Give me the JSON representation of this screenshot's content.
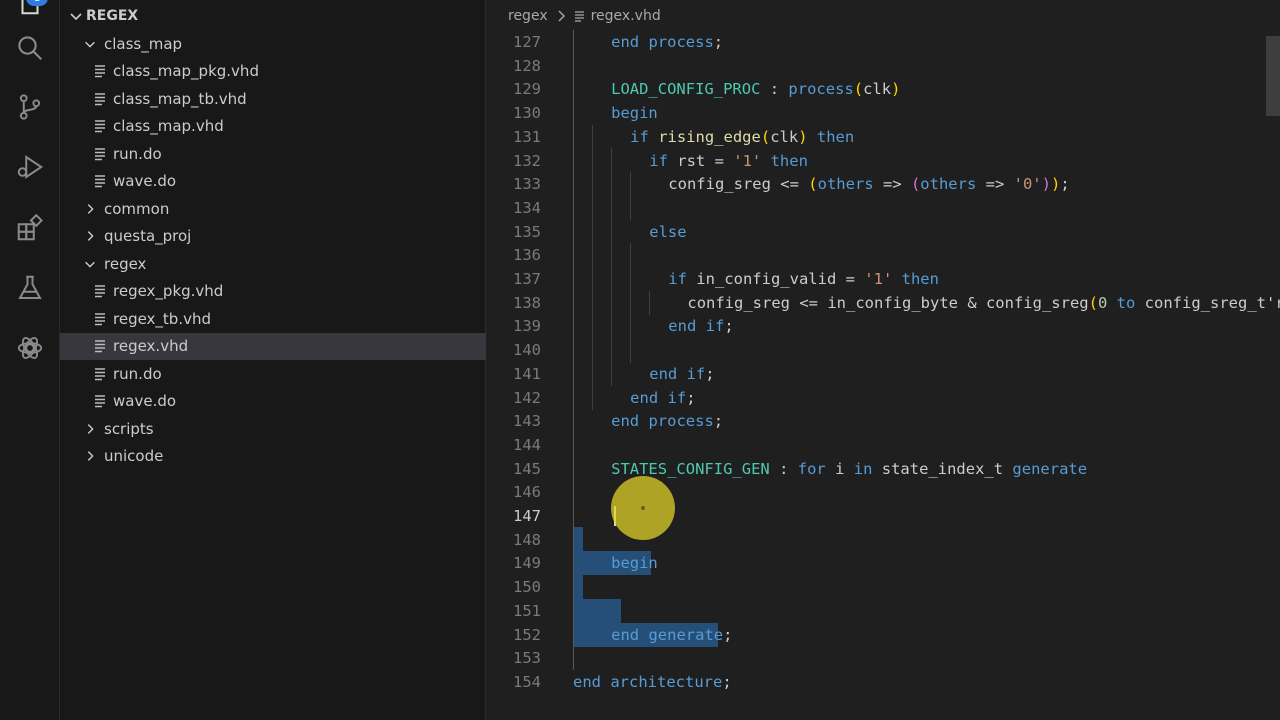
{
  "activity_bar": {
    "badge": "1",
    "icons": [
      "explorer-icon",
      "search-icon",
      "source-control-icon",
      "run-debug-icon",
      "extensions-icon",
      "testing-icon",
      "chatgpt-icon"
    ]
  },
  "explorer": {
    "root_label": "REGEX",
    "tree": [
      {
        "label": "class_map",
        "type": "folder",
        "expanded": true,
        "depth": 1
      },
      {
        "label": "class_map_pkg.vhd",
        "type": "file",
        "depth": 2
      },
      {
        "label": "class_map_tb.vhd",
        "type": "file",
        "depth": 2
      },
      {
        "label": "class_map.vhd",
        "type": "file",
        "depth": 2
      },
      {
        "label": "run.do",
        "type": "file",
        "depth": 2
      },
      {
        "label": "wave.do",
        "type": "file",
        "depth": 2
      },
      {
        "label": "common",
        "type": "folder",
        "expanded": false,
        "depth": 1
      },
      {
        "label": "questa_proj",
        "type": "folder",
        "expanded": false,
        "depth": 1
      },
      {
        "label": "regex",
        "type": "folder",
        "expanded": true,
        "depth": 1
      },
      {
        "label": "regex_pkg.vhd",
        "type": "file",
        "depth": 2
      },
      {
        "label": "regex_tb.vhd",
        "type": "file",
        "depth": 2
      },
      {
        "label": "regex.vhd",
        "type": "file",
        "depth": 2,
        "selected": true
      },
      {
        "label": "run.do",
        "type": "file",
        "depth": 2
      },
      {
        "label": "wave.do",
        "type": "file",
        "depth": 2
      },
      {
        "label": "scripts",
        "type": "folder",
        "expanded": false,
        "depth": 1
      },
      {
        "label": "unicode",
        "type": "folder",
        "expanded": false,
        "depth": 1
      }
    ]
  },
  "breadcrumb": {
    "folder": "regex",
    "file": "regex.vhd"
  },
  "editor": {
    "current_line": 147,
    "lines": [
      {
        "n": "127",
        "indent": 4,
        "tokens": [
          [
            "kw",
            "end"
          ],
          [
            "t",
            " "
          ],
          [
            "kw",
            "process"
          ],
          [
            "t",
            ";"
          ]
        ]
      },
      {
        "n": "128",
        "indent": 0,
        "tokens": []
      },
      {
        "n": "129",
        "indent": 4,
        "tokens": [
          [
            "ent",
            "LOAD_CONFIG_PROC"
          ],
          [
            "t",
            " : "
          ],
          [
            "kw",
            "process"
          ],
          [
            "brk1",
            "("
          ],
          [
            "t",
            "clk"
          ],
          [
            "brk1",
            ")"
          ]
        ]
      },
      {
        "n": "130",
        "indent": 4,
        "tokens": [
          [
            "kw",
            "begin"
          ]
        ]
      },
      {
        "n": "131",
        "indent": 6,
        "tokens": [
          [
            "kw",
            "if"
          ],
          [
            "t",
            " "
          ],
          [
            "fn",
            "rising_edge"
          ],
          [
            "brk1",
            "("
          ],
          [
            "t",
            "clk"
          ],
          [
            "brk1",
            ")"
          ],
          [
            "t",
            " "
          ],
          [
            "kw",
            "then"
          ]
        ]
      },
      {
        "n": "132",
        "indent": 8,
        "tokens": [
          [
            "kw",
            "if"
          ],
          [
            "t",
            " rst = "
          ],
          [
            "str",
            "'1'"
          ],
          [
            "t",
            " "
          ],
          [
            "kw",
            "then"
          ]
        ]
      },
      {
        "n": "133",
        "indent": 10,
        "tokens": [
          [
            "t",
            "config_sreg <= "
          ],
          [
            "brk1",
            "("
          ],
          [
            "kw",
            "others"
          ],
          [
            "t",
            " => "
          ],
          [
            "brk2",
            "("
          ],
          [
            "kw",
            "others"
          ],
          [
            "t",
            " => "
          ],
          [
            "str",
            "'0'"
          ],
          [
            "brk2",
            ")"
          ],
          [
            "brk1",
            ")"
          ],
          [
            "t",
            ";"
          ]
        ]
      },
      {
        "n": "134",
        "indent": 0,
        "tokens": []
      },
      {
        "n": "135",
        "indent": 8,
        "tokens": [
          [
            "kw",
            "else"
          ]
        ]
      },
      {
        "n": "136",
        "indent": 0,
        "tokens": []
      },
      {
        "n": "137",
        "indent": 10,
        "tokens": [
          [
            "kw",
            "if"
          ],
          [
            "t",
            " in_config_valid = "
          ],
          [
            "str",
            "'1'"
          ],
          [
            "t",
            " "
          ],
          [
            "kw",
            "then"
          ]
        ]
      },
      {
        "n": "138",
        "indent": 12,
        "tokens": [
          [
            "t",
            "config_sreg <= in_config_byte & config_sreg"
          ],
          [
            "brk1",
            "("
          ],
          [
            "num",
            "0"
          ],
          [
            "t",
            " "
          ],
          [
            "kw",
            "to"
          ],
          [
            "t",
            " config_sreg_t'r"
          ]
        ]
      },
      {
        "n": "139",
        "indent": 10,
        "tokens": [
          [
            "kw",
            "end"
          ],
          [
            "t",
            " "
          ],
          [
            "kw",
            "if"
          ],
          [
            "t",
            ";"
          ]
        ]
      },
      {
        "n": "140",
        "indent": 0,
        "tokens": []
      },
      {
        "n": "141",
        "indent": 8,
        "tokens": [
          [
            "kw",
            "end"
          ],
          [
            "t",
            " "
          ],
          [
            "kw",
            "if"
          ],
          [
            "t",
            ";"
          ]
        ]
      },
      {
        "n": "142",
        "indent": 6,
        "tokens": [
          [
            "kw",
            "end"
          ],
          [
            "t",
            " "
          ],
          [
            "kw",
            "if"
          ],
          [
            "t",
            ";"
          ]
        ]
      },
      {
        "n": "143",
        "indent": 4,
        "tokens": [
          [
            "kw",
            "end"
          ],
          [
            "t",
            " "
          ],
          [
            "kw",
            "process"
          ],
          [
            "t",
            ";"
          ]
        ]
      },
      {
        "n": "144",
        "indent": 0,
        "tokens": []
      },
      {
        "n": "145",
        "indent": 4,
        "tokens": [
          [
            "ent",
            "STATES_CONFIG_GEN"
          ],
          [
            "t",
            " : "
          ],
          [
            "kw",
            "for"
          ],
          [
            "t",
            " i "
          ],
          [
            "kw",
            "in"
          ],
          [
            "t",
            " state_index_t "
          ],
          [
            "kw",
            "generate"
          ]
        ]
      },
      {
        "n": "146",
        "indent": 0,
        "tokens": []
      },
      {
        "n": "147",
        "indent": 0,
        "tokens": []
      },
      {
        "n": "148",
        "indent": 0,
        "tokens": []
      },
      {
        "n": "149",
        "indent": 4,
        "tokens": [
          [
            "kw",
            "begin"
          ]
        ]
      },
      {
        "n": "150",
        "indent": 0,
        "tokens": []
      },
      {
        "n": "151",
        "indent": 4,
        "tokens": [
          [
            "t",
            "    "
          ]
        ]
      },
      {
        "n": "152",
        "indent": 4,
        "tokens": [
          [
            "kw",
            "end"
          ],
          [
            "t",
            " "
          ],
          [
            "kw",
            "generate"
          ],
          [
            "t",
            ";"
          ]
        ]
      },
      {
        "n": "153",
        "indent": 0,
        "tokens": []
      },
      {
        "n": "154",
        "indent": 0,
        "tokens": [
          [
            "kw",
            "end"
          ],
          [
            "t",
            " "
          ],
          [
            "kw",
            "architecture"
          ],
          [
            "t",
            ";"
          ]
        ]
      }
    ]
  }
}
